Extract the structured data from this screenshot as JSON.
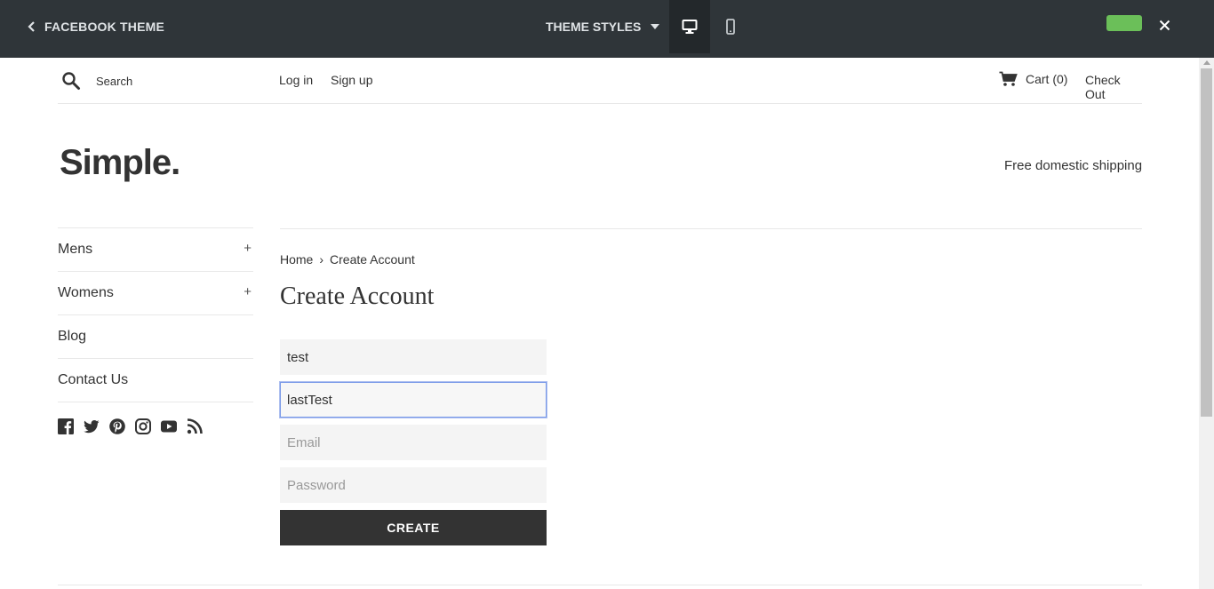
{
  "editor": {
    "back_label": "FACEBOOK THEME",
    "theme_styles_label": "THEME STYLES",
    "save_color": "#6bbf59",
    "bar_color": "#2f3539",
    "icons": [
      "chevron-left-icon",
      "caret-down-icon",
      "desktop-icon",
      "mobile-icon",
      "close-icon"
    ]
  },
  "util": {
    "search_placeholder": "Search",
    "login": "Log in",
    "signup": "Sign up",
    "cart": "Cart (0)",
    "checkout": "Check Out"
  },
  "header": {
    "logo": "Simple.",
    "shipping": "Free domestic shipping"
  },
  "sidebar": {
    "items": [
      {
        "label": "Mens",
        "expand": "+"
      },
      {
        "label": "Womens",
        "expand": "+"
      },
      {
        "label": "Blog"
      },
      {
        "label": "Contact Us"
      }
    ],
    "social_icons": [
      "facebook-icon",
      "twitter-icon",
      "pinterest-icon",
      "instagram-icon",
      "youtube-icon",
      "rss-icon"
    ]
  },
  "main": {
    "breadcrumb": {
      "home": "Home",
      "separator": "›",
      "current": "Create Account"
    },
    "title": "Create Account",
    "form": {
      "first_name_value": "test",
      "last_name_value": "lastTest",
      "email_placeholder": "Email",
      "password_placeholder": "Password",
      "submit_label": "CREATE"
    }
  }
}
